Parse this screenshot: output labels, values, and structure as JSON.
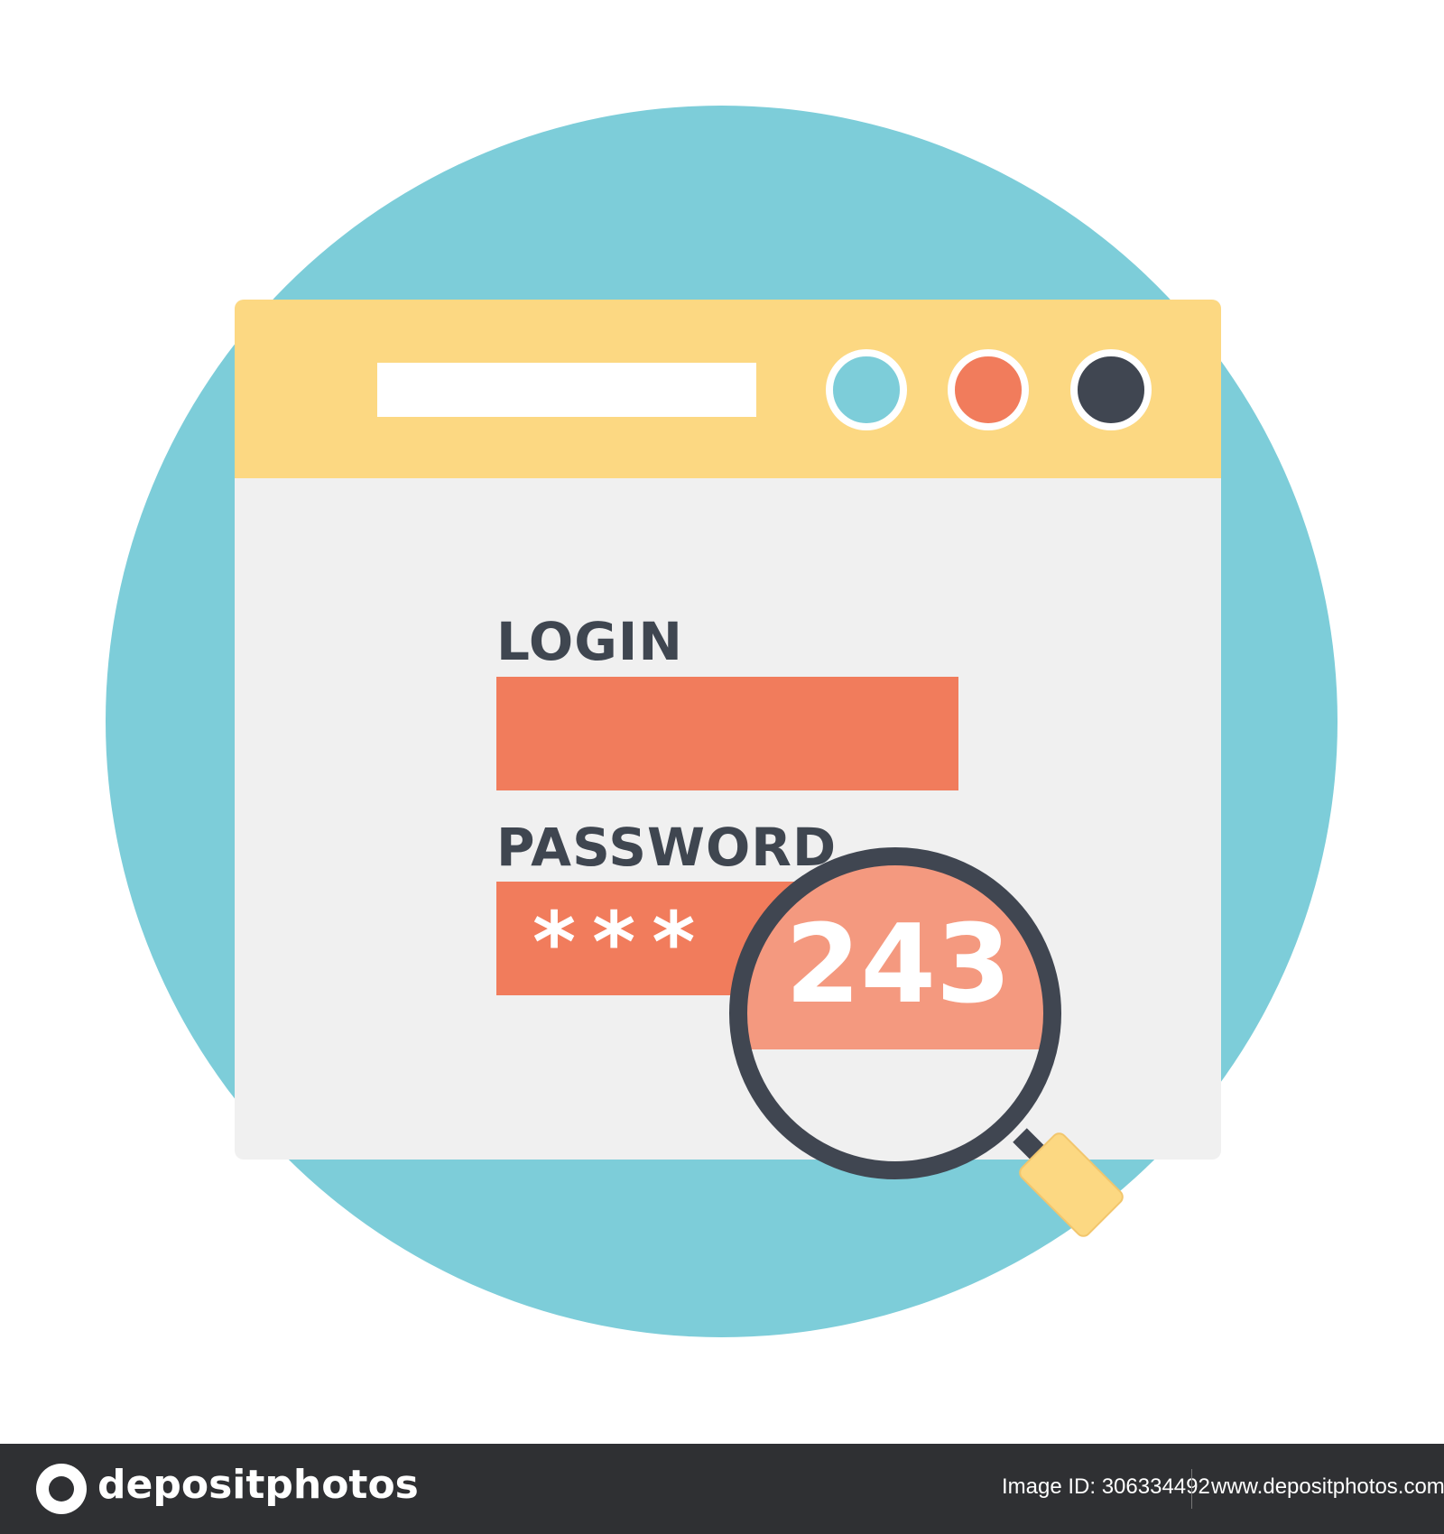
{
  "login_form": {
    "login_label": "LOGIN",
    "password_label": "PASSWORD",
    "password_mask": "***",
    "revealed_digits": "243"
  },
  "footer": {
    "brand": "depositphotos",
    "image_id": "Image ID: 306334492",
    "url": "www.depositphotos.com"
  },
  "colors": {
    "circle": "#7dcdd9",
    "title_bar": "#fcd882",
    "field": "#f17c5c",
    "lens_highlight": "#f4997f",
    "dark": "#404651"
  },
  "icons": [
    "magnifying-glass-icon",
    "window-control-dot-icon"
  ]
}
